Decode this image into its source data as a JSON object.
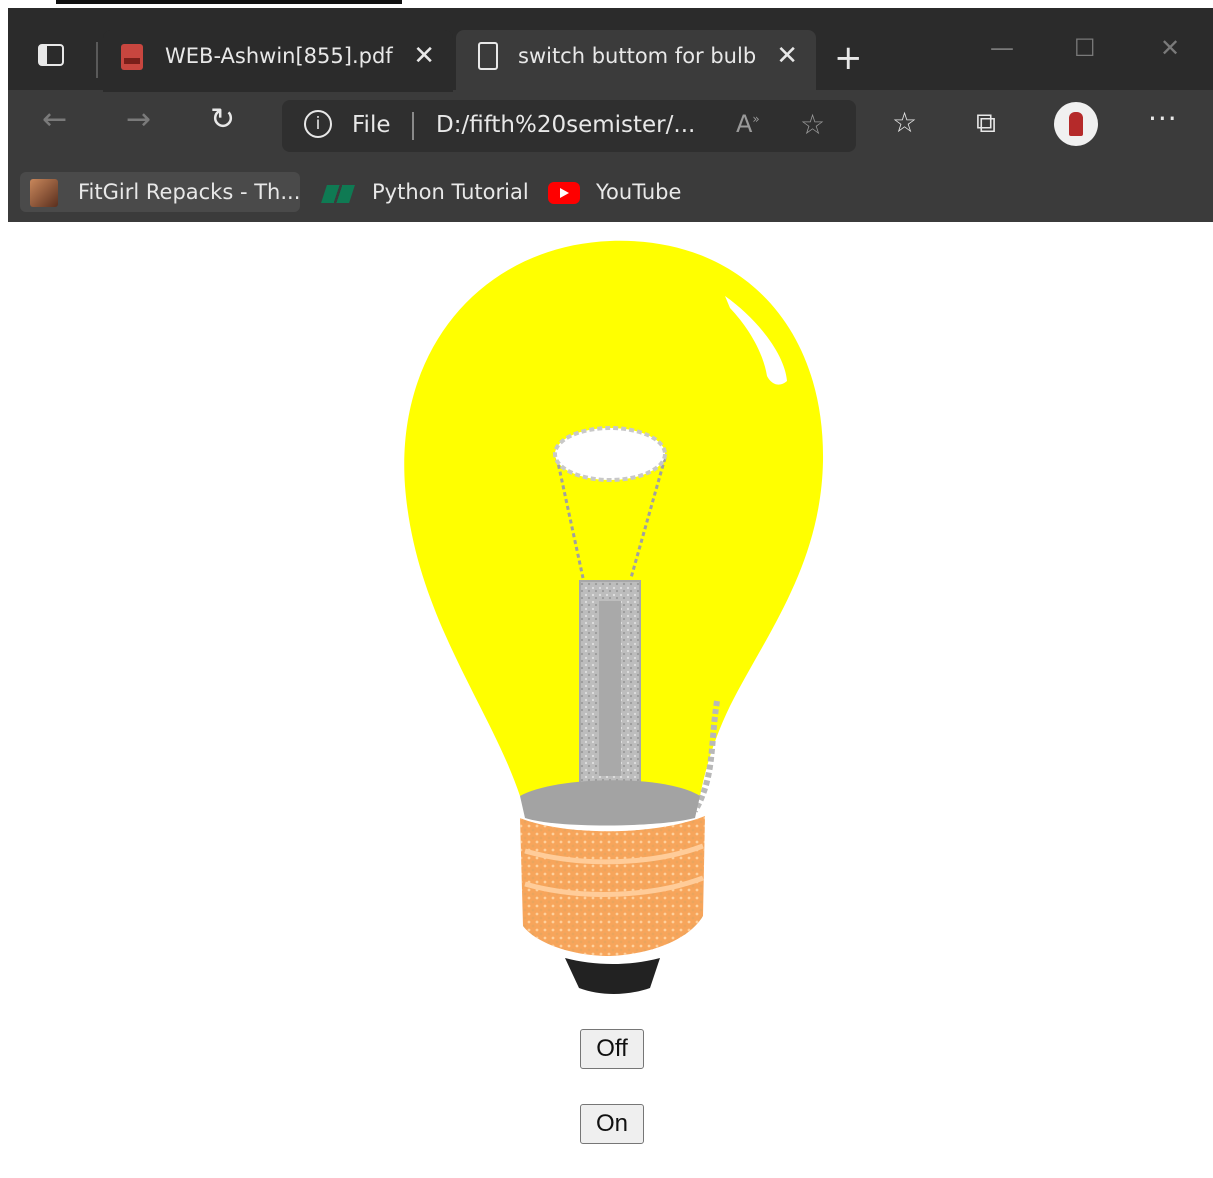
{
  "browser": {
    "tabs": [
      {
        "label": "WEB-Ashwin[855].pdf",
        "active": false,
        "icon": "pdf-icon"
      },
      {
        "label": "switch buttom for bulb",
        "active": true,
        "icon": "page-icon"
      }
    ],
    "tab_close_glyph": "✕",
    "new_tab_glyph": "+",
    "window_controls": {
      "minimize": "—",
      "maximize": "☐",
      "close": "✕"
    },
    "address": {
      "scheme_label": "File",
      "url": "D:/fifth%20semister/..."
    },
    "bookmarks": [
      {
        "label": "FitGirl Repacks - Th...",
        "icon": "fitgirl-icon"
      },
      {
        "label": "Python Tutorial",
        "icon": "w3schools-icon"
      },
      {
        "label": "YouTube",
        "icon": "youtube-icon"
      }
    ]
  },
  "page": {
    "bulb_state": "on",
    "bulb_color": "#ffff00",
    "buttons": {
      "off_label": "Off",
      "on_label": "On"
    }
  }
}
